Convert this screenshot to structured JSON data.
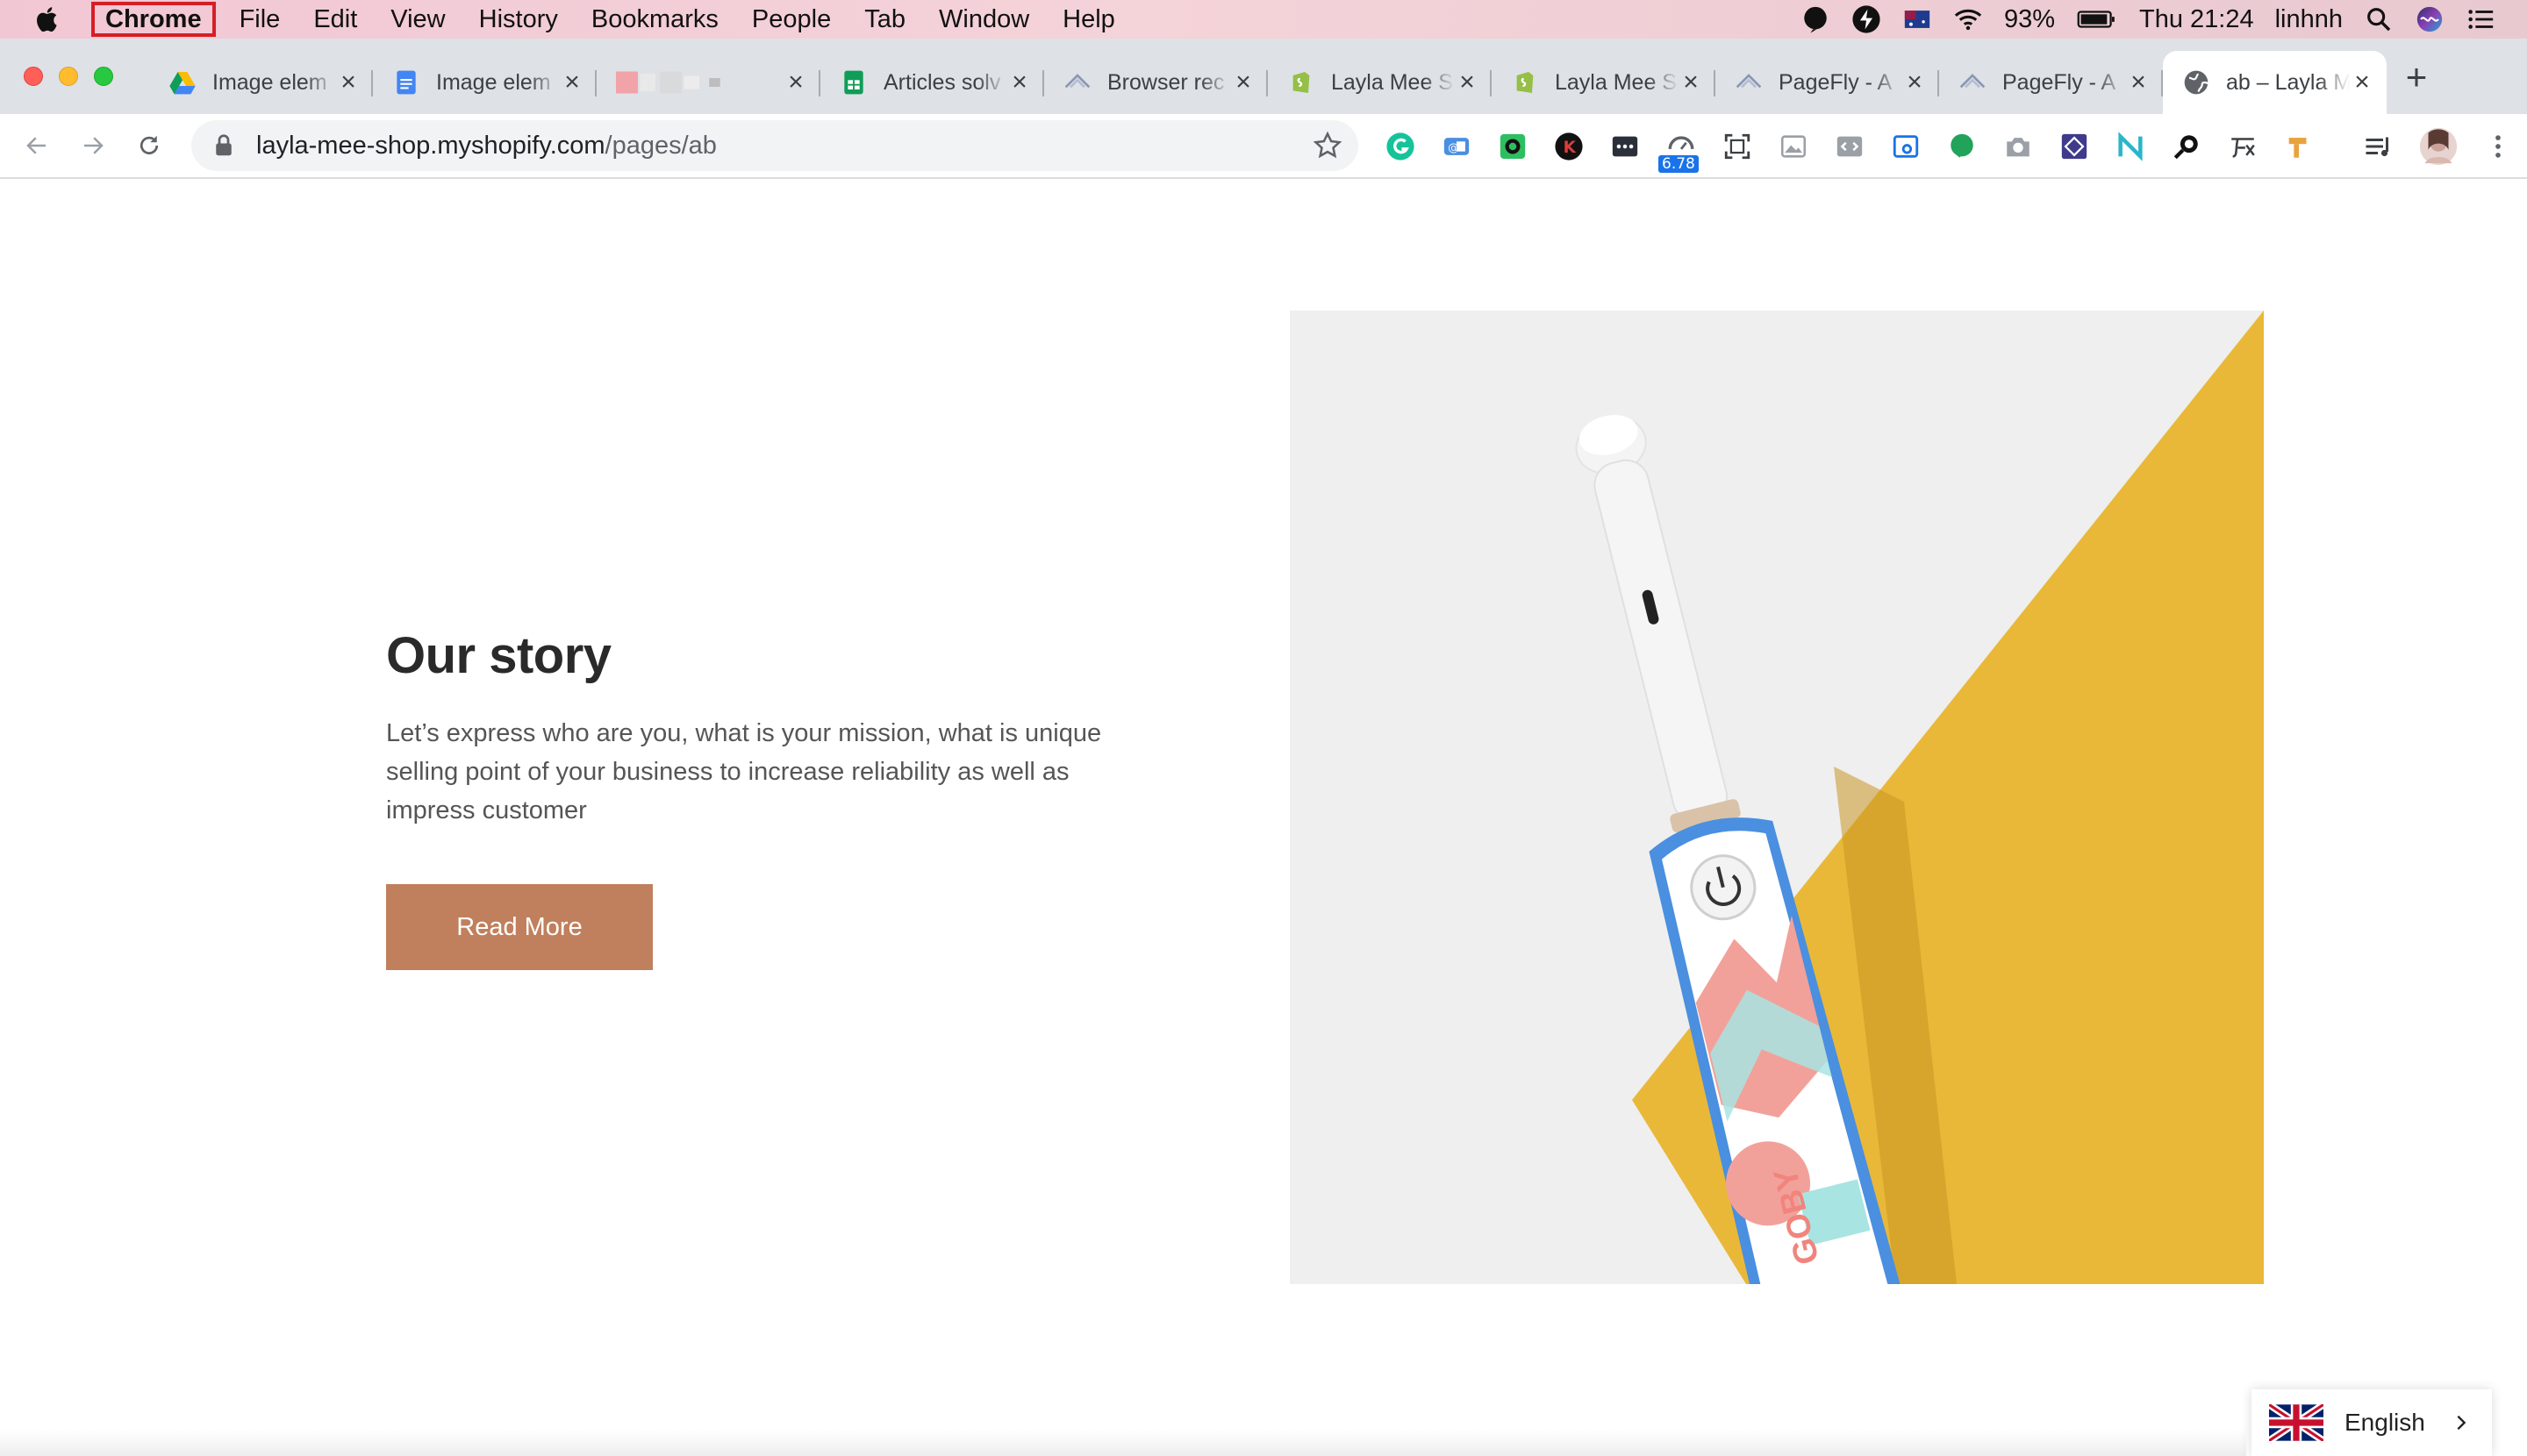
{
  "menubar": {
    "app_name": "Chrome",
    "items": [
      "File",
      "Edit",
      "View",
      "History",
      "Bookmarks",
      "People",
      "Tab",
      "Window",
      "Help"
    ],
    "battery": "93%",
    "clock": "Thu 21:24",
    "user": "linhnh"
  },
  "tabs": [
    {
      "label": "Image elem",
      "icon": "google-drive-icon",
      "close": "×"
    },
    {
      "label": "Image elem",
      "icon": "google-docs-icon",
      "close": "×"
    },
    {
      "label": "",
      "icon": "blurred-icon",
      "close": "×"
    },
    {
      "label": "Articles solv",
      "icon": "google-sheets-icon",
      "close": "×"
    },
    {
      "label": "Browser rec",
      "icon": "pagefly-icon",
      "close": "×"
    },
    {
      "label": "Layla Mee S",
      "icon": "shopify-icon",
      "close": "×"
    },
    {
      "label": "Layla Mee S",
      "icon": "shopify-icon",
      "close": "×"
    },
    {
      "label": "PageFly - A",
      "icon": "pagefly-icon",
      "close": "×"
    },
    {
      "label": "PageFly - A",
      "icon": "pagefly-icon",
      "close": "×"
    },
    {
      "label": "ab – Layla M",
      "icon": "globe-icon",
      "close": "×"
    }
  ],
  "new_tab": "+",
  "address": {
    "host": "layla-mee-shop.myshopify.com",
    "path": "/pages/ab"
  },
  "extensions": {
    "badge": "6.78"
  },
  "page": {
    "title": "Our story",
    "body": "Let’s express who are you, what is your mission, what is unique selling point of your business to increase reliability as well as impress customer",
    "button": "Read More",
    "brush_text": "GOBY"
  },
  "language": {
    "label": "English"
  },
  "colors": {
    "button": "#c0805d",
    "hero_yellow": "#eab838",
    "hero_bg": "#efefef",
    "brush_blue": "#4a8fe0",
    "brush_pink": "#f2a19a",
    "brush_cyan": "#a8e4e2"
  }
}
